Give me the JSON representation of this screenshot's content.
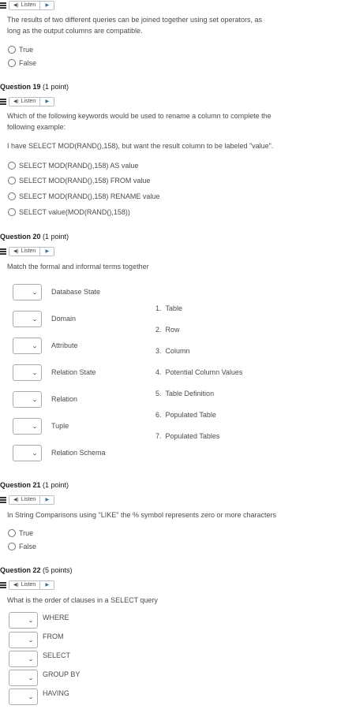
{
  "listen": {
    "label": "Listen"
  },
  "q18": {
    "text_line1": "The results of two different queries can be joined together using set operators, as",
    "text_line2": "long as the output columns are compatible.",
    "options": [
      "True",
      "False"
    ]
  },
  "q19": {
    "title": "Question 19",
    "points": "(1 point)",
    "text_line1": "Which of the following keywords would be used to rename a column to complete the",
    "text_line2": "following example:",
    "example": "I have SELECT MOD(RAND(),158), but want the result column to be labeled \"value\".",
    "options": [
      "SELECT MOD(RAND(),158) AS value",
      "SELECT MOD(RAND(),158) FROM value",
      "SELECT MOD(RAND(),158) RENAME value",
      "SELECT value(MOD(RAND(),158))"
    ]
  },
  "q20": {
    "title": "Question 20",
    "points": "(1 point)",
    "text": "Match the formal and informal terms together",
    "left_items": [
      "Database State",
      "Domain",
      "Attribute",
      "Relation State",
      "Relation",
      "Tuple",
      "Relation Schema"
    ],
    "right_items": [
      {
        "num": "1.",
        "label": "Table"
      },
      {
        "num": "2.",
        "label": "Row"
      },
      {
        "num": "3.",
        "label": "Column"
      },
      {
        "num": "4.",
        "label": "Potential Column Values"
      },
      {
        "num": "5.",
        "label": "Table Definition"
      },
      {
        "num": "6.",
        "label": "Populated Table"
      },
      {
        "num": "7.",
        "label": "Populated Tables"
      }
    ]
  },
  "q21": {
    "title": "Question 21",
    "points": "(1 point)",
    "text": "In String Comparisons using \"LIKE\" the % symbol represents zero or more characters",
    "options": [
      "True",
      "False"
    ]
  },
  "q22": {
    "title": "Question 22",
    "points": "(5 points)",
    "text": "What is the order of clauses in a SELECT query",
    "items": [
      "WHERE",
      "FROM",
      "SELECT",
      "GROUP BY",
      "HAVING"
    ]
  }
}
